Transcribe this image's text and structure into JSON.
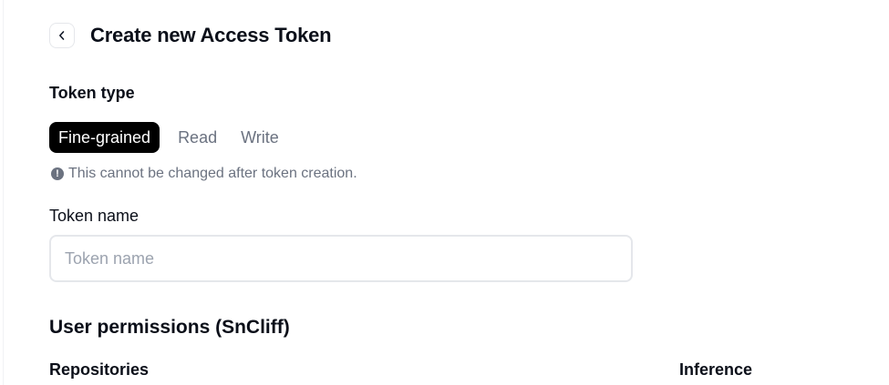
{
  "header": {
    "title": "Create new Access Token",
    "back_icon": "chevron-left-icon"
  },
  "token_type": {
    "label": "Token type",
    "options": [
      "Fine-grained",
      "Read",
      "Write"
    ],
    "selected": "Fine-grained",
    "hint_icon": "info-icon",
    "hint_icon_glyph": "!",
    "hint": "This cannot be changed after token creation."
  },
  "token_name": {
    "label": "Token name",
    "placeholder": "Token name",
    "value": ""
  },
  "permissions": {
    "title": "User permissions (SnCliff)",
    "repositories_label": "Repositories",
    "inference_label": "Inference"
  },
  "colors": {
    "active_segment_bg": "#000000",
    "active_segment_text": "#ffffff",
    "muted_text": "#6b7280",
    "border": "#e5e7eb"
  }
}
